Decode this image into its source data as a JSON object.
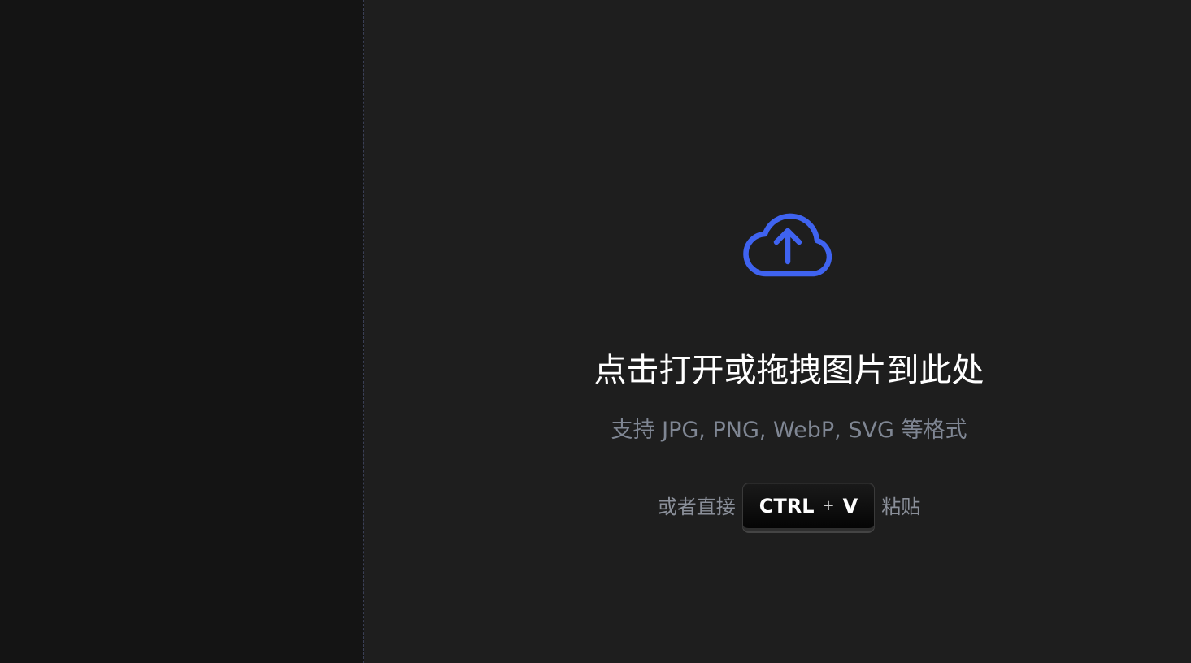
{
  "dropzone": {
    "icon": "cloud-upload-icon",
    "accent_color": "#3f63f0",
    "title": "点击打开或拖拽图片到此处",
    "subtitle": "支持 JPG, PNG, WebP, SVG 等格式",
    "paste_prefix": "或者直接",
    "paste_suffix": "粘贴",
    "shortcut": {
      "key1": "CTRL",
      "plus": "+",
      "key2": "V"
    }
  }
}
